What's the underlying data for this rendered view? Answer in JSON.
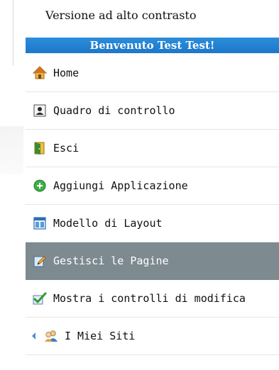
{
  "header": {
    "contrast_link": "Versione ad alto contrasto",
    "welcome": "Benvenuto Test Test!"
  },
  "menu": {
    "items": [
      {
        "label": "Home",
        "icon": "home-icon",
        "active": false
      },
      {
        "label": "Quadro di controllo",
        "icon": "user-panel-icon",
        "active": false
      },
      {
        "label": "Esci",
        "icon": "exit-door-icon",
        "active": false
      },
      {
        "label": "Aggiungi Applicazione",
        "icon": "add-circle-icon",
        "active": false
      },
      {
        "label": "Modello di Layout",
        "icon": "layout-icon",
        "active": false
      },
      {
        "label": "Gestisci le Pagine",
        "icon": "edit-pencil-icon",
        "active": true
      },
      {
        "label": "Mostra i controlli di modifica",
        "icon": "checkmark-icon",
        "active": false
      },
      {
        "label": "I Miei Siti",
        "icon": "users-icon",
        "active": false
      }
    ]
  },
  "colors": {
    "welcome_bar": "#1c78c8",
    "active_item": "#7d8a90"
  }
}
